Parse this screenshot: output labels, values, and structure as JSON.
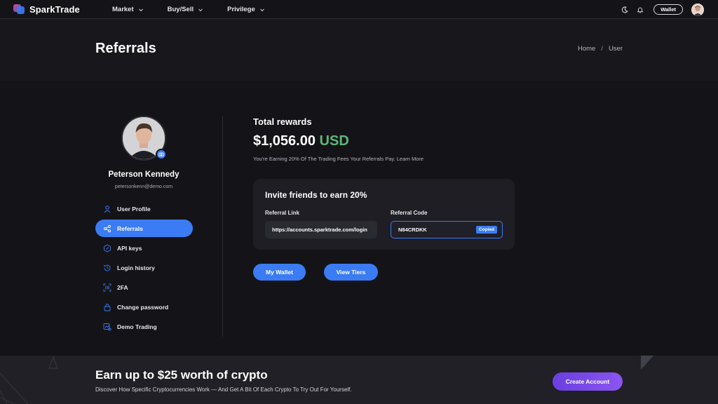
{
  "app": {
    "brand": "SparkTrade"
  },
  "nav": {
    "items": [
      {
        "label": "Market"
      },
      {
        "label": "Buy/Sell"
      },
      {
        "label": "Privilege"
      }
    ],
    "wallet_label": "Wallet"
  },
  "header": {
    "title": "Referrals",
    "breadcrumb": [
      "Home",
      "User"
    ],
    "breadcrumb_sep": "/"
  },
  "profile": {
    "name": "Peterson Kennedy",
    "email": "petersonkenn@demo.com"
  },
  "sidebar": {
    "items": [
      {
        "label": "User Profile",
        "icon": "user-icon",
        "active": false
      },
      {
        "label": "Referrals",
        "icon": "share-icon",
        "active": true
      },
      {
        "label": "API keys",
        "icon": "api-key-icon",
        "active": false
      },
      {
        "label": "Login history",
        "icon": "history-icon",
        "active": false
      },
      {
        "label": "2FA",
        "icon": "qr-scan-icon",
        "active": false
      },
      {
        "label": "Change password",
        "icon": "lock-icon",
        "active": false
      },
      {
        "label": "Demo Trading",
        "icon": "demo-chart-icon",
        "active": false
      }
    ]
  },
  "rewards": {
    "label": "Total rewards",
    "amount": "$1,056.00",
    "currency": "USD",
    "description": "You're Earning 20% Of The Trading Fees Your Referrals Pay. Learn More"
  },
  "invite": {
    "title": "Invite friends to earn 20%",
    "link_label": "Referral Link",
    "link_value": "https://accounts.sparktrade.com/login",
    "code_label": "Referral Code",
    "code_value": "N84CRDKK",
    "copied_label": "Copied"
  },
  "actions": {
    "my_wallet": "My Wallet",
    "view_tiers": "View Tiers"
  },
  "promo": {
    "title": "Earn up to $25 worth of crypto",
    "description": "Discover How Specific Cryptocurrencies Work — And Get A Bit Of Each Crypto To Try Out For Yourself.",
    "cta": "Create Account"
  },
  "colors": {
    "accent": "#3b7cf5",
    "success": "#5cb877",
    "cta_purple": "#7a4ae8",
    "background": "#141418"
  }
}
